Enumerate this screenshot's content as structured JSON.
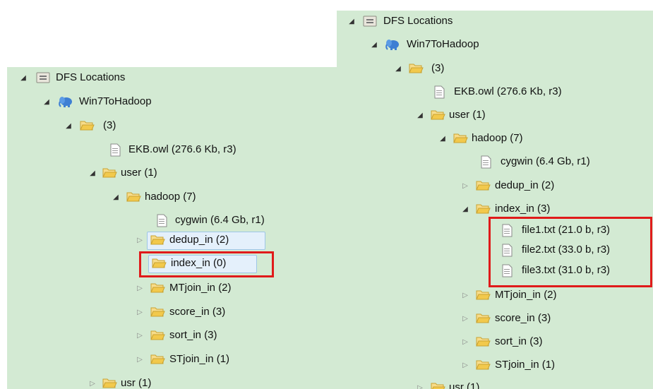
{
  "left_tree": {
    "root": "DFS Locations",
    "connection": "Win7ToHadoop",
    "root_dir": "(3)",
    "file_ekb": "EKB.owl (276.6 Kb, r3)",
    "user": "user (1)",
    "hadoop": "hadoop (7)",
    "cygwin": "cygwin (6.4 Gb, r1)",
    "dedup": "dedup_in (2)",
    "index": "index_in (0)",
    "mtjoin": "MTjoin_in (2)",
    "score": "score_in (3)",
    "sort": "sort_in (3)",
    "stjoin": "STjoin_in (1)",
    "usr": "usr (1)"
  },
  "right_tree": {
    "root": "DFS Locations",
    "connection": "Win7ToHadoop",
    "root_dir": "(3)",
    "file_ekb": "EKB.owl (276.6 Kb, r3)",
    "user": "user (1)",
    "hadoop": "hadoop (7)",
    "cygwin": "cygwin (6.4 Gb, r1)",
    "dedup": "dedup_in (2)",
    "index": "index_in (3)",
    "file1": "file1.txt (21.0 b, r3)",
    "file2": "file2.txt (33.0 b, r3)",
    "file3": "file3.txt (31.0 b, r3)",
    "mtjoin": "MTjoin_in (2)",
    "score": "score_in (3)",
    "sort": "sort_in (3)",
    "stjoin": "STjoin_in (1)",
    "usr": "usr (1)"
  },
  "colors": {
    "panel_bg": "#d3ead3",
    "highlight_box": "#e01a1a",
    "folder": "#f2c94c",
    "selection": "#e4f0fb"
  },
  "icons": {
    "expanded": "triangle-down-icon",
    "collapsed": "triangle-right-icon",
    "folder": "folder-open-icon",
    "file": "file-icon",
    "dfs": "dfs-locations-icon",
    "hadoop": "hadoop-elephant-icon"
  }
}
